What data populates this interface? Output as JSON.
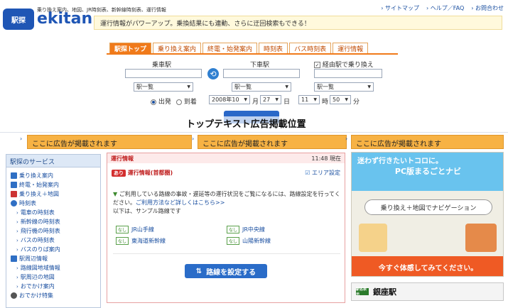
{
  "header": {
    "logo_badge": "駅探",
    "logo_text": "ekitan",
    "service_links": "乗り換え案内、地図、JR時刻表、新幹線時刻表、運行情報",
    "top_links": [
      "サイトマップ",
      "ヘルプ／FAQ",
      "お問合わせ"
    ],
    "notice": "運行情報がパワーアップ。乗換結果にも連動、さらに迂回検索もできる！"
  },
  "tabs": [
    "駅探トップ",
    "乗り換え案内",
    "終電・始発案内",
    "時刻表",
    "バス時刻表",
    "運行情報"
  ],
  "search": {
    "from_label": "乗車駅",
    "to_label": "下車駅",
    "via_label": "経由駅で乗り換え",
    "from_list": "駅一覧",
    "to_list": "駅一覧",
    "via_list": "駅一覧",
    "depart": "出発",
    "arrive": "到着",
    "year_month": "2008年10",
    "month_unit": "月",
    "day": "27",
    "day_unit": "日",
    "hour": "11",
    "hour_unit": "時",
    "minute": "50",
    "minute_unit": "分",
    "search_button": "検索"
  },
  "headline": "トップテキスト広告掲載位置",
  "ads": [
    "ここに広告が掲載されます",
    "ここに広告が掲載されます",
    "ここに広告が掲載されます"
  ],
  "sidebar": {
    "title": "駅探のサービス",
    "items": [
      {
        "label": "乗り換え案内",
        "icon_color": "#2f6fc4"
      },
      {
        "label": "終電・始発案内",
        "icon_color": "#2f6fc4"
      },
      {
        "label": "乗り換え＋地図",
        "icon_color": "#c33"
      },
      {
        "label": "時刻表",
        "icon_color": "#2f6fc4"
      },
      {
        "label": "電車の時刻表"
      },
      {
        "label": "新幹線の時刻表"
      },
      {
        "label": "飛行機の時刻表"
      },
      {
        "label": "バスの時刻表"
      },
      {
        "label": "バスのりば案内"
      },
      {
        "label": "駅周辺情報",
        "icon_color": "#2f6fc4"
      },
      {
        "label": "路線図地域情報"
      },
      {
        "label": "駅周辺の地図"
      },
      {
        "label": "おでかけ案内"
      },
      {
        "label": "おでかけ特集",
        "icon_color": "#555"
      }
    ]
  },
  "panel": {
    "title": "運行情報",
    "time": "11:48",
    "time_suffix": "現在",
    "tag": "あり",
    "region_title": "運行情報(",
    "region": "首都圏",
    "region_close": ")",
    "area_link": "エリア設定",
    "message": "ご利用している路線の事故・遅延等の運行状況をご覧になるには、路線設定を行ってください。",
    "howto_link": "ご利用方法など詳しくはこちら>>",
    "sample": "以下は、サンプル路線です",
    "lines": [
      {
        "tag": "なし",
        "name": "JR山手線"
      },
      {
        "tag": "なし",
        "name": "JR中央線"
      },
      {
        "tag": "なし",
        "name": "東海道新幹線"
      },
      {
        "tag": "なし",
        "name": "山陽新幹線"
      }
    ],
    "route_button": "路線を設定する"
  },
  "right_ad": {
    "line1": "迷わず行きたいトコロに。",
    "line2": "PC版まるごとナビ",
    "pill": "乗り換え＋地図でナビゲーション",
    "bottom": "今すぐ体感してみてください。"
  },
  "station": {
    "icon_text": "駅名表示",
    "name": "銀座駅"
  }
}
